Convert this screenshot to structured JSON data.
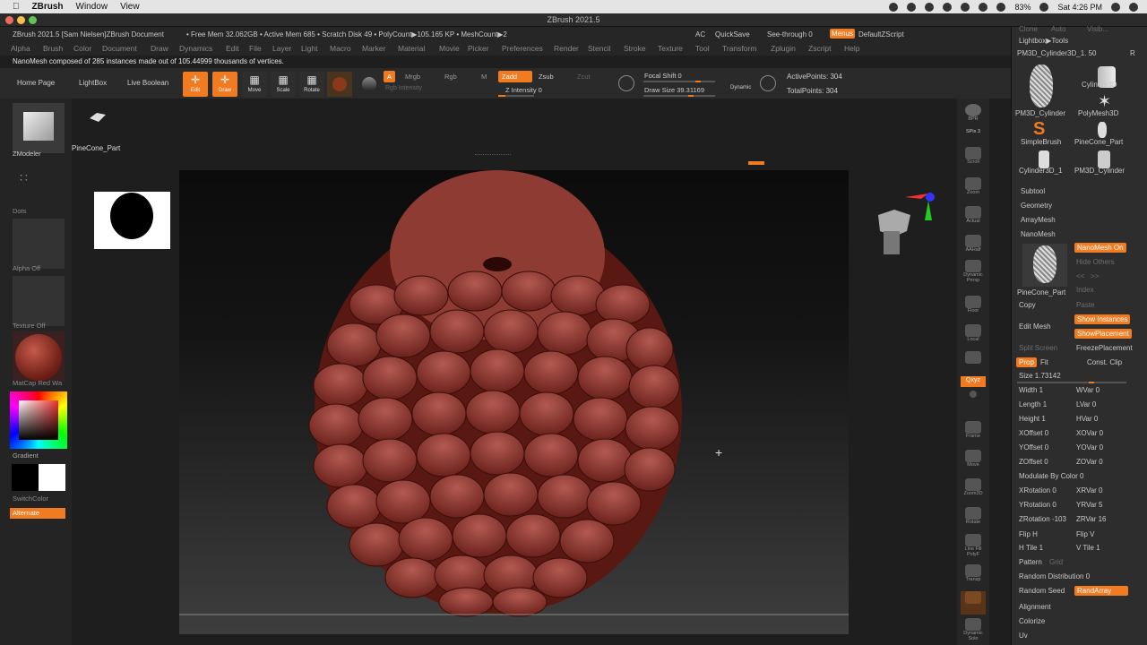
{
  "macbar": {
    "app": "ZBrush",
    "menus": [
      "Window",
      "View"
    ],
    "battery": "83%",
    "clock": "Sat 4:26 PM"
  },
  "window": {
    "title": "ZBrush 2021.5"
  },
  "info": {
    "doc": "ZBrush 2021.5 [Sam Nielsen]ZBrush Document",
    "mem": "• Free Mem 32.062GB • Active Mem 685 • Scratch Disk 49 • PolyCount▶105.165 KP • MeshCount▶2",
    "ac": "AC",
    "quicksave": "QuickSave",
    "seethrough": "See-through  0",
    "menus": "Menus",
    "defaultscript": "DefaultZScript"
  },
  "menubar": [
    "Alpha",
    "Brush",
    "Color",
    "Document",
    "Draw",
    "Dynamics",
    "Edit",
    "File",
    "Layer",
    "Light",
    "Macro",
    "Marker",
    "Material",
    "Movie",
    "Picker",
    "Preferences",
    "Render",
    "Stencil",
    "Stroke",
    "Texture",
    "Tool",
    "Transform",
    "Zplugin",
    "Zscript",
    "Help"
  ],
  "notice": "NanoMesh composed of 285 instances made out of 105.44999 thousands of vertices.",
  "toolbar": {
    "home": "Home Page",
    "lightbox": "LightBox",
    "liveboolean": "Live Boolean",
    "edit": "Edit",
    "draw": "Draw",
    "move": "Move",
    "scale": "Scale",
    "rotate": "Rotate",
    "a": "A",
    "mrgb": "Mrgb",
    "rgb": "Rgb",
    "m": "M",
    "zadd": "Zadd",
    "zsub": "Zsub",
    "zcut": "Zcut",
    "rgbintensity": "Rgb Intensity",
    "zintensity": "Z Intensity 0",
    "focalshift": "Focal Shift 0",
    "drawsize": "Draw Size 39.31169",
    "dynamic": "Dynamic",
    "activepoints": "ActivePoints: 304",
    "totalpoints": "TotalPoints: 304"
  },
  "doc": {
    "tool_label": "PineCone_Part"
  },
  "leftshelf": {
    "zmodeler": "ZModeler",
    "dots": "Dots",
    "alpha": "Alpha Off",
    "texture": "Texture Off",
    "matcap": "MatCap Red Wa",
    "gradient": "Gradient",
    "switchcolor": "SwitchColor",
    "alternate": "Alternate"
  },
  "rightshelf": {
    "items": [
      "BPR",
      "SPix 3",
      "Scroll",
      "Zoom",
      "Actual",
      "AAHalf",
      "Dynamic Persp",
      "Floor",
      "Local",
      "",
      "Qxyz",
      "",
      "",
      "Frame",
      "Move",
      "Zoom3D",
      "Rotate",
      "Line Fill PolyF",
      "Transp",
      "",
      "Dynamic Solo"
    ]
  },
  "palette": {
    "header_tabs": [
      "Clone",
      "Auto",
      "Visib..."
    ],
    "lightbox_tools": "Lightbox▶Tools",
    "current_tool": "PM3D_Cylinder3D_1. 50",
    "r": "R",
    "thumbs": [
      "PM3D_Cylinder",
      "Cylinder3D",
      "PM3D_Cylinder",
      "PolyMesh3D",
      "SimpleBrush",
      "PineCone_Part",
      "Cylinder3D_1",
      "PM3D_Cylinder"
    ],
    "subtool": "Subtool",
    "geometry": "Geometry",
    "arraymesh": "ArrayMesh",
    "nanomesh": "NanoMesh",
    "nanomesh_on": "NanoMesh On",
    "hide_others": "Hide Others",
    "pinecone_part": "PineCone_Part",
    "index": "Index",
    "copy": "Copy",
    "paste": "Paste",
    "edit_mesh": "Edit Mesh",
    "show_instances": "Show Instances",
    "show_placement": "ShowPlacement",
    "split_screen": "Split Screen",
    "freeze_placement": "FreezePlacement",
    "prop": "Prop",
    "fit": "Fit",
    "const_clip": "Const. Clip",
    "size": "Size 1.73142",
    "width": "Width 1",
    "wvar": "WVar 0",
    "length": "Length 1",
    "lvar": "LVar 0",
    "height": "Height 1",
    "hvar": "HVar 0",
    "xoffset": "XOffset 0",
    "xovar": "XOVar 0",
    "yoffset": "YOffset 0",
    "yovar": "YOVar 0",
    "zoffset": "ZOffset 0",
    "zovar": "ZOVar 0",
    "modulate": "Modulate By Color 0",
    "xrotation": "XRotation 0",
    "xrvar": "XRVar 0",
    "yrotation": "YRotation 0",
    "yrvar": "YRVar 5",
    "zrotation": "ZRotation -103",
    "zrvar": "ZRVar 16",
    "fliph": "Flip H",
    "flipv": "Flip V",
    "htile": "H Tile 1",
    "vtile": "V Tile 1",
    "pattern": "Pattern",
    "grid": "Grid",
    "random_distribution": "Random Distribution 0",
    "random_seed": "Random Seed",
    "randarray": "RandArray",
    "alignment": "Alignment",
    "colorize": "Colorize",
    "uv": "Uv"
  }
}
